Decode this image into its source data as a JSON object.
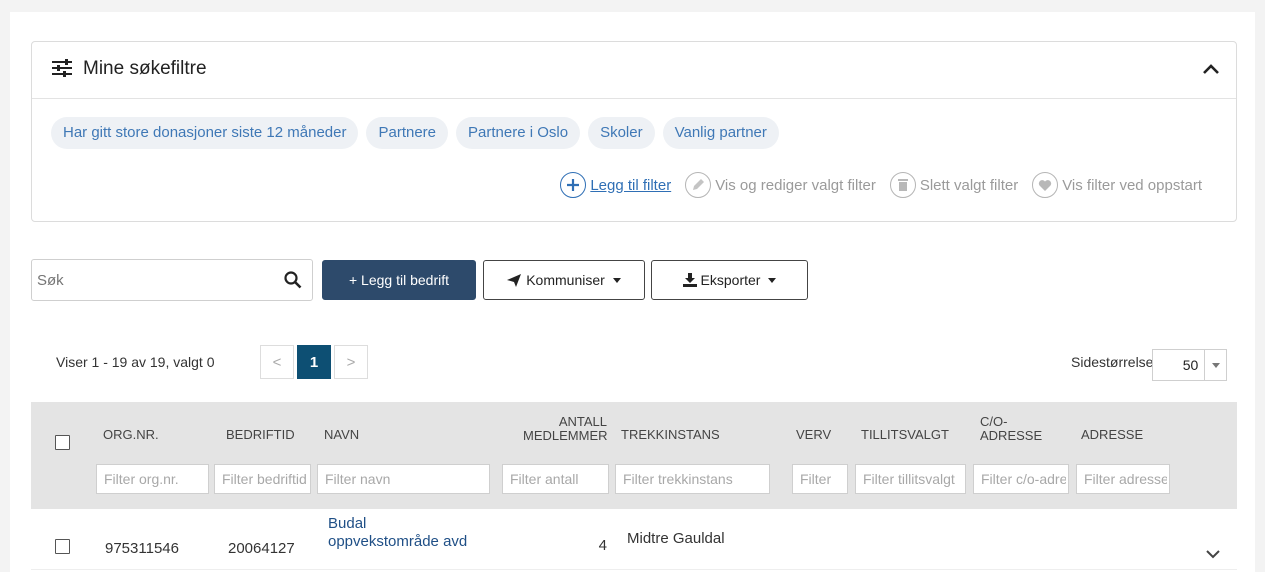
{
  "filter_panel": {
    "title": "Mine søkefiltre",
    "chips": [
      "Har gitt store donasjoner siste 12 måneder",
      "Partnere",
      "Partnere i Oslo",
      "Skoler",
      "Vanlig partner"
    ],
    "actions": {
      "add": "Legg til filter",
      "edit": "Vis og rediger valgt filter",
      "delete": "Slett valgt filter",
      "startup": "Vis filter ved oppstart"
    }
  },
  "toolbar": {
    "search_placeholder": "Søk",
    "add_company": "+ Legg til bedrift",
    "communicate": "Kommuniser",
    "export": "Eksporter"
  },
  "pagination": {
    "summary": "Viser 1 - 19 av 19, valgt 0",
    "prev": "<",
    "current_page": "1",
    "next": ">",
    "page_size_label": "Sidestørrelse:",
    "page_size": "50"
  },
  "table": {
    "columns": [
      {
        "label": "ORG.NR.",
        "filter": "Filter org.nr."
      },
      {
        "label": "BEDRIFTID",
        "filter": "Filter bedriftid"
      },
      {
        "label": "NAVN",
        "filter": "Filter navn"
      },
      {
        "label_line1": "ANTALL",
        "label_line2": "MEDLEMMER",
        "filter": "Filter antall"
      },
      {
        "label": "TREKKINSTANS",
        "filter": "Filter trekkinstans"
      },
      {
        "label": "VERV",
        "filter": "Filter"
      },
      {
        "label": "TILLITSVALGT",
        "filter": "Filter tillitsvalgt"
      },
      {
        "label_line1": "C/O-",
        "label_line2": "ADRESSE",
        "filter": "Filter c/o-adresse"
      },
      {
        "label": "ADRESSE",
        "filter": "Filter adresse"
      }
    ],
    "rows": [
      {
        "org_nr": "975311546",
        "bedriftid": "20064127",
        "navn_line1": "Budal",
        "navn_line2": "oppvekstområde avd",
        "antall": "4",
        "trekkinstans": "Midtre Gauldal"
      }
    ]
  }
}
